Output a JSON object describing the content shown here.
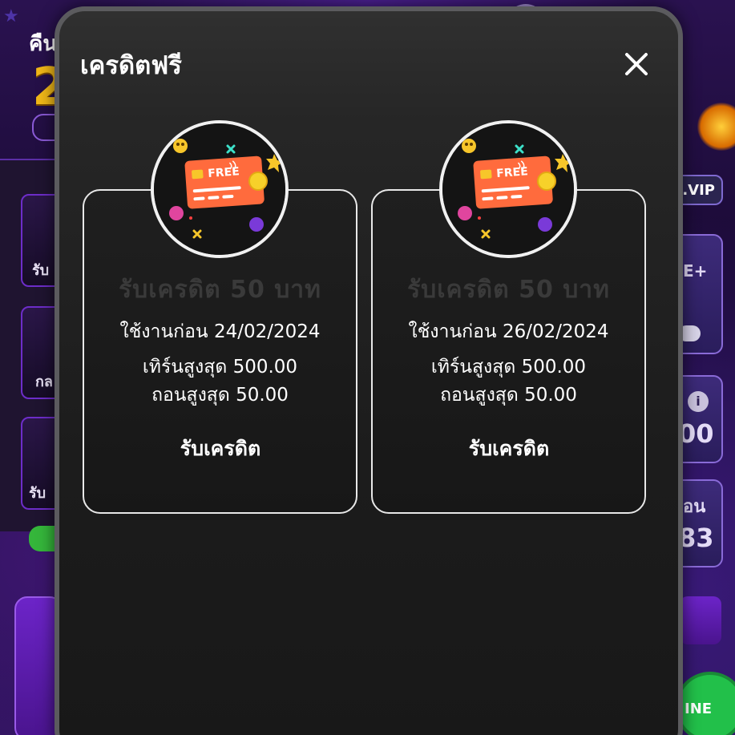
{
  "background": {
    "top_left_label": "คืน",
    "big_number": "2",
    "vip_badge": ".VIP",
    "right_card_label": "E+",
    "right_value_1": "00",
    "right_label_2": "อน",
    "right_value_2": "83",
    "line_button": "INE",
    "tile_labels": [
      "รับ",
      "กล",
      "รับ"
    ]
  },
  "modal": {
    "title": "เครดิตฟรี",
    "close_icon": "close-icon"
  },
  "cards": [
    {
      "amount": "รับเครดิต 50 บาท",
      "expiry": "ใช้งานก่อน 24/02/2024",
      "turnover": "เทิร์นสูงสุด 500.00",
      "withdraw": "ถอนสูงสุด 50.00",
      "claim_label": "รับเครดิต",
      "icon_text": "FREE"
    },
    {
      "amount": "รับเครดิต 50 บาท",
      "expiry": "ใช้งานก่อน 26/02/2024",
      "turnover": "เทิร์นสูงสุด 500.00",
      "withdraw": "ถอนสูงสุด 50.00",
      "claim_label": "รับเครดิต",
      "icon_text": "FREE"
    }
  ],
  "colors": {
    "card_orange": "#ff6b3d",
    "coin_yellow": "#f7d12a",
    "modal_bg": "#1c1c1c",
    "card_border": "#e8e8e8"
  }
}
